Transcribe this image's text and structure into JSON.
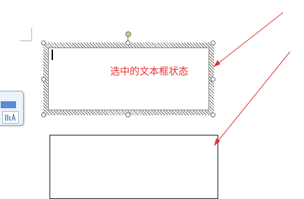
{
  "annotation": {
    "label": "选中的文本框状态",
    "arrow_color": "#e83030"
  },
  "icons": {
    "left_widget": "paragraph-layout-icon",
    "rotate": "rotate-handle-icon"
  }
}
